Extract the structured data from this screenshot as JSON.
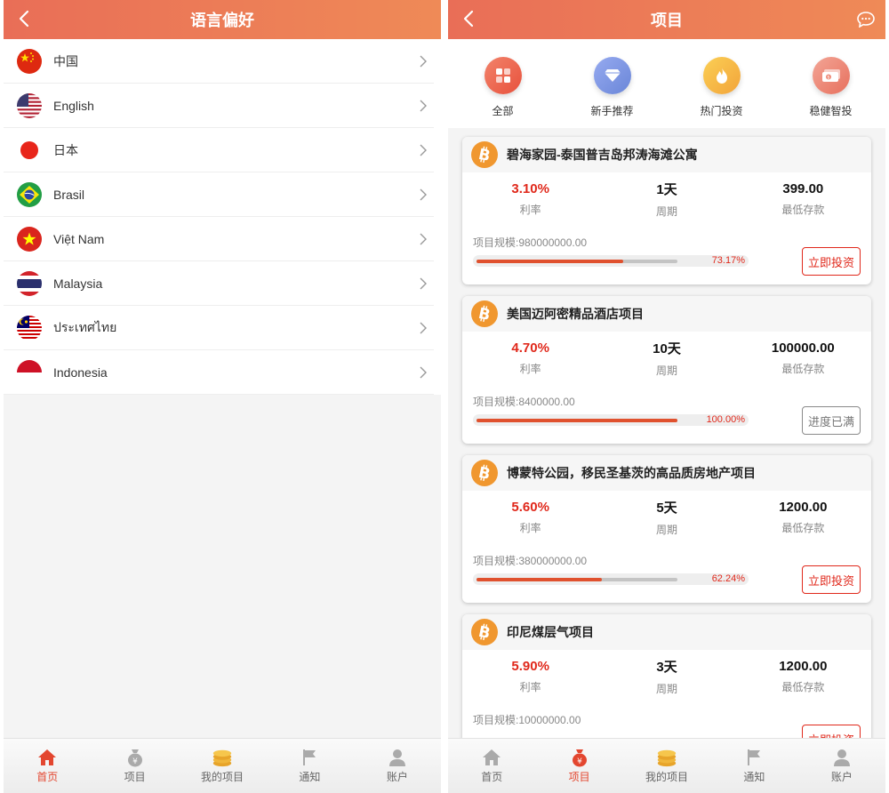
{
  "language_screen": {
    "title": "语言偏好",
    "languages": [
      {
        "label": "中国"
      },
      {
        "label": "English"
      },
      {
        "label": "日本"
      },
      {
        "label": "Brasil"
      },
      {
        "label": "Việt Nam"
      },
      {
        "label": "Malaysia"
      },
      {
        "label": "ประเทศไทย"
      },
      {
        "label": "Indonesia"
      }
    ]
  },
  "project_screen": {
    "title": "项目",
    "categories": [
      {
        "label": "全部",
        "icon": "grid-icon",
        "color": "#ef6a4e"
      },
      {
        "label": "新手推荐",
        "icon": "diamond-icon",
        "color": "#7b95e3"
      },
      {
        "label": "热门投资",
        "icon": "flame-icon",
        "color": "#f6b63f"
      },
      {
        "label": "稳健智投",
        "icon": "money-icon",
        "color": "#ee8a78"
      }
    ],
    "projects": [
      {
        "name": "碧海家园-泰国普吉岛邦涛海滩公寓",
        "rate": "3.10%",
        "rate_label": "利率",
        "period": "1天",
        "period_label": "周期",
        "min": "399.00",
        "min_label": "最低存款",
        "scale": "项目规模:980000000.00",
        "progress": 73.17,
        "progress_text": "73.17%",
        "button": "立即投资",
        "button_state": "active"
      },
      {
        "name": "美国迈阿密精品酒店项目",
        "rate": "4.70%",
        "rate_label": "利率",
        "period": "10天",
        "period_label": "周期",
        "min": "100000.00",
        "min_label": "最低存款",
        "scale": "项目规模:8400000.00",
        "progress": 100,
        "progress_text": "100.00%",
        "button": "进度已满",
        "button_state": "full"
      },
      {
        "name": "博蒙特公园，移民圣基茨的高品质房地产项目",
        "rate": "5.60%",
        "rate_label": "利率",
        "period": "5天",
        "period_label": "周期",
        "min": "1200.00",
        "min_label": "最低存款",
        "scale": "项目规模:380000000.00",
        "progress": 62.24,
        "progress_text": "62.24%",
        "button": "立即投资",
        "button_state": "active"
      },
      {
        "name": "印尼煤层气项目",
        "rate": "5.90%",
        "rate_label": "利率",
        "period": "3天",
        "period_label": "周期",
        "min": "1200.00",
        "min_label": "最低存款",
        "scale": "项目规模:10000000.00",
        "progress": 0,
        "progress_text": "",
        "button": "立即投资",
        "button_state": "active"
      }
    ]
  },
  "tabbar": {
    "tabs": [
      {
        "label": "首页",
        "icon": "home-icon"
      },
      {
        "label": "项目",
        "icon": "money-bag-icon"
      },
      {
        "label": "我的项目",
        "icon": "coin-stack-icon"
      },
      {
        "label": "通知",
        "icon": "flag-icon"
      },
      {
        "label": "账户",
        "icon": "user-icon"
      }
    ],
    "left_active": 0,
    "right_active": 1,
    "active_color": "#e3462f"
  },
  "colors": {
    "header_start": "#e96e57",
    "header_end": "#ef8a57",
    "accent_red": "#e0281b"
  }
}
